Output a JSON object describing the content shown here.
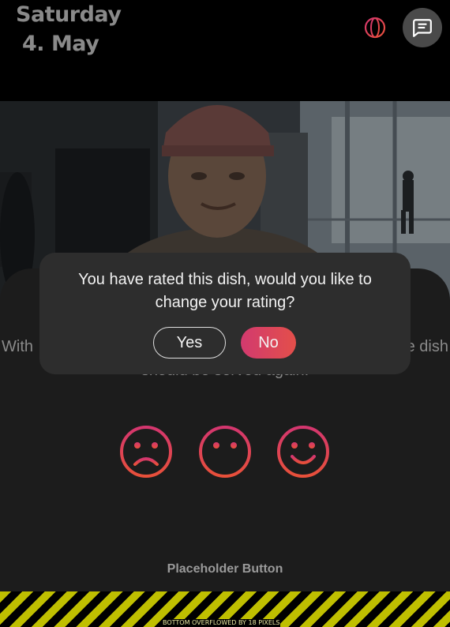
{
  "header": {
    "day": "Saturday",
    "date": "4. May",
    "globe_icon": "globe-icon",
    "chat_icon": "chat-icon"
  },
  "photo": {
    "description_icon": "dish-photo"
  },
  "rating": {
    "prompt_line1": "With",
    "prompt_end": "e dish",
    "prompt_line2": "should be served again.",
    "faces": [
      "sad-face-icon",
      "neutral-face-icon",
      "happy-face-icon"
    ]
  },
  "placeholder_button": "Placeholder Button",
  "overflow_warning": "BOTTOM OVERFLOWED BY 18 PIXELS",
  "dialog": {
    "message": "You have rated this dish, would you like to change your rating?",
    "yes_label": "Yes",
    "no_label": "No"
  },
  "colors": {
    "accent_start": "#d23a6f",
    "accent_end": "#e34f4a",
    "face_gradient_top": "#d4366f",
    "face_gradient_bottom": "#e8503a"
  }
}
